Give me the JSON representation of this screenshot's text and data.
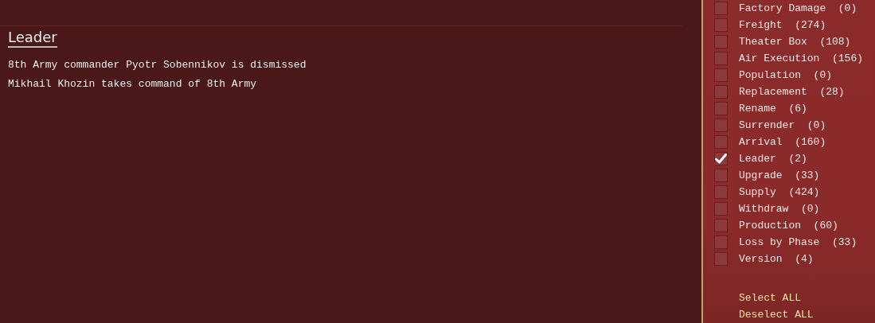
{
  "report": {
    "heading": "Leader",
    "lines": [
      "8th Army commander Pyotr Sobennikov is dismissed",
      "Mikhail Khozin takes command of 8th Army"
    ]
  },
  "filters": [
    {
      "label": "Factory Damage  (0)",
      "checked": false
    },
    {
      "label": "Freight  (274)",
      "checked": false
    },
    {
      "label": "Theater Box  (108)",
      "checked": false
    },
    {
      "label": "Air Execution  (156)",
      "checked": false
    },
    {
      "label": "Population  (0)",
      "checked": false
    },
    {
      "label": "Replacement  (28)",
      "checked": false
    },
    {
      "label": "Rename  (6)",
      "checked": false
    },
    {
      "label": "Surrender  (0)",
      "checked": false
    },
    {
      "label": "Arrival  (160)",
      "checked": false
    },
    {
      "label": "Leader  (2)",
      "checked": true
    },
    {
      "label": "Upgrade  (33)",
      "checked": false
    },
    {
      "label": "Supply  (424)",
      "checked": false
    },
    {
      "label": "Withdraw  (0)",
      "checked": false
    },
    {
      "label": "Production  (60)",
      "checked": false
    },
    {
      "label": "Loss by Phase  (33)",
      "checked": false
    },
    {
      "label": "Version  (4)",
      "checked": false
    }
  ],
  "actions": [
    "Select ALL",
    "Deselect ALL"
  ]
}
